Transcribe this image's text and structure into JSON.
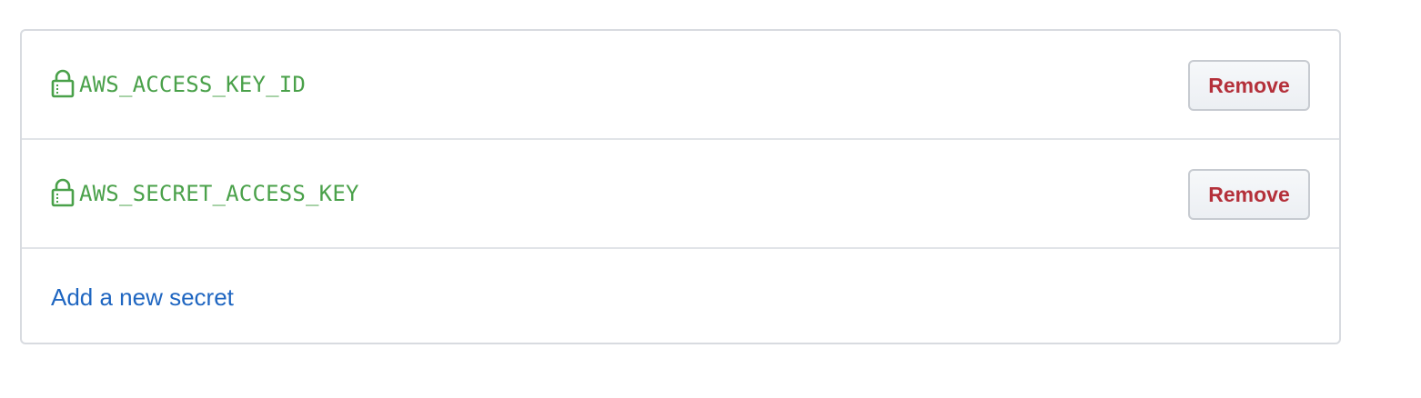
{
  "secrets": {
    "items": [
      {
        "name": "AWS_ACCESS_KEY_ID",
        "remove_label": "Remove",
        "icon": "lock-icon"
      },
      {
        "name": "AWS_SECRET_ACCESS_KEY",
        "remove_label": "Remove",
        "icon": "lock-icon"
      }
    ],
    "add_link_label": "Add a new secret"
  },
  "colors": {
    "secret_name": "#4aa14a",
    "remove_text": "#b4303a",
    "link": "#1f66c1",
    "border": "#d8dbe0"
  }
}
